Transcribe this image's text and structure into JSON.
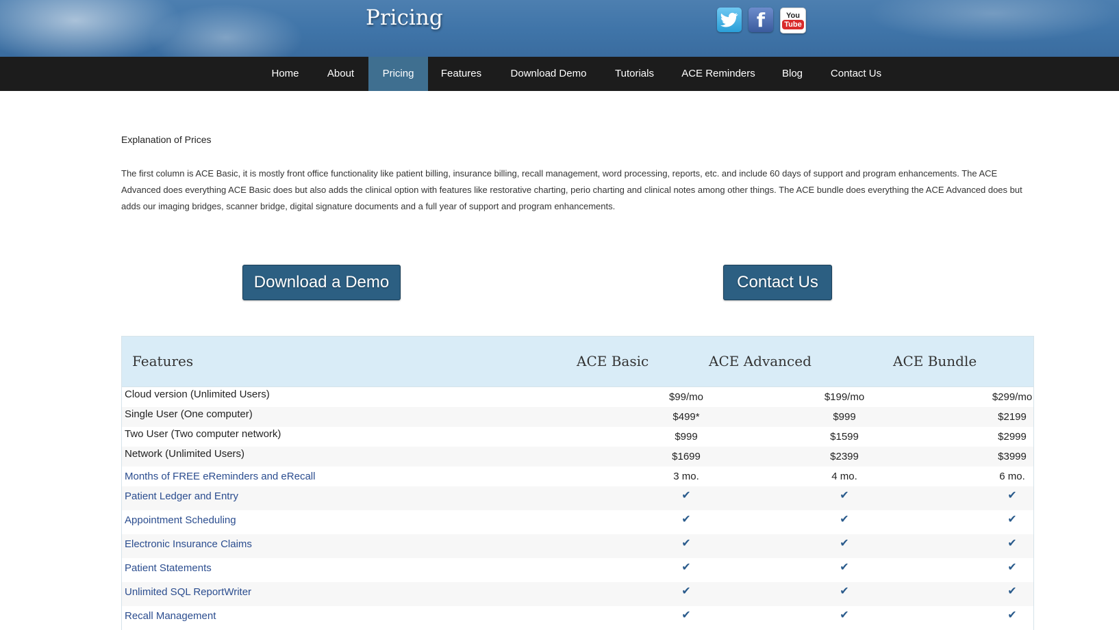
{
  "header": {
    "title": "Pricing",
    "social": [
      {
        "name": "twitter-icon",
        "glyph": "🐦"
      },
      {
        "name": "facebook-icon",
        "glyph": "f"
      },
      {
        "name": "youtube-icon",
        "top": "You",
        "bottom": "Tube"
      }
    ]
  },
  "nav": {
    "items": [
      {
        "label": "Home"
      },
      {
        "label": "About"
      },
      {
        "label": "Pricing",
        "active": true
      },
      {
        "label": "Features"
      },
      {
        "label": "Download Demo"
      },
      {
        "label": "Tutorials"
      },
      {
        "label": "ACE Reminders"
      },
      {
        "label": "Blog"
      },
      {
        "label": "Contact Us"
      }
    ]
  },
  "content": {
    "heading": "Explanation of Prices",
    "intro": "The first column is ACE Basic, it is mostly front office functionality like patient billing, insurance billing, recall management, word processing, reports, etc. and include 60 days of support and program enhancements. The ACE Advanced does everything ACE Basic does but also adds the clinical option with features like restorative charting, perio charting and clinical notes among other things. The ACE bundle does everything the ACE Advanced does but adds our imaging bridges, scanner bridge, digital signature documents and a full year of support and program enhancements.",
    "download_button": "Download a Demo",
    "contact_button": "Contact Us"
  },
  "table": {
    "headers": [
      "Features",
      "ACE Basic",
      "ACE Advanced",
      "ACE Bundle"
    ],
    "check_glyph": "✔",
    "rows": [
      {
        "label": "Cloud version (Unlimited Users)",
        "link": false,
        "values": [
          "$99/mo",
          "$199/mo",
          "$299/mo"
        ]
      },
      {
        "label": "Single User (One computer)",
        "link": false,
        "values": [
          "$499*",
          "$999",
          "$2199"
        ]
      },
      {
        "label": "Two User (Two computer network)",
        "link": false,
        "values": [
          "$999",
          "$1599",
          "$2999"
        ]
      },
      {
        "label": "Network (Unlimited Users)",
        "link": false,
        "values": [
          "$1699",
          "$2399",
          "$3999"
        ]
      },
      {
        "label": "Months of FREE eReminders and eRecall",
        "link": true,
        "values": [
          "3 mo.",
          "4 mo.",
          "6 mo."
        ]
      },
      {
        "label": "Patient Ledger and Entry",
        "link": true,
        "checks": [
          true,
          true,
          true
        ]
      },
      {
        "label": "Appointment Scheduling",
        "link": true,
        "checks": [
          true,
          true,
          true
        ]
      },
      {
        "label": "Electronic Insurance Claims",
        "link": true,
        "checks": [
          true,
          true,
          true
        ]
      },
      {
        "label": "Patient Statements",
        "link": true,
        "checks": [
          true,
          true,
          true
        ]
      },
      {
        "label": "Unlimited SQL ReportWriter",
        "link": true,
        "checks": [
          true,
          true,
          true
        ]
      },
      {
        "label": "Recall Management",
        "link": true,
        "checks": [
          true,
          true,
          true
        ]
      }
    ]
  },
  "colors": {
    "nav_bg": "#1c1c1c",
    "nav_active": "#3f6f90",
    "button_bg": "#2c5f82",
    "table_header_bg": "#d9ecf7",
    "link": "#2b4d8f",
    "check": "#2a5b8c"
  }
}
